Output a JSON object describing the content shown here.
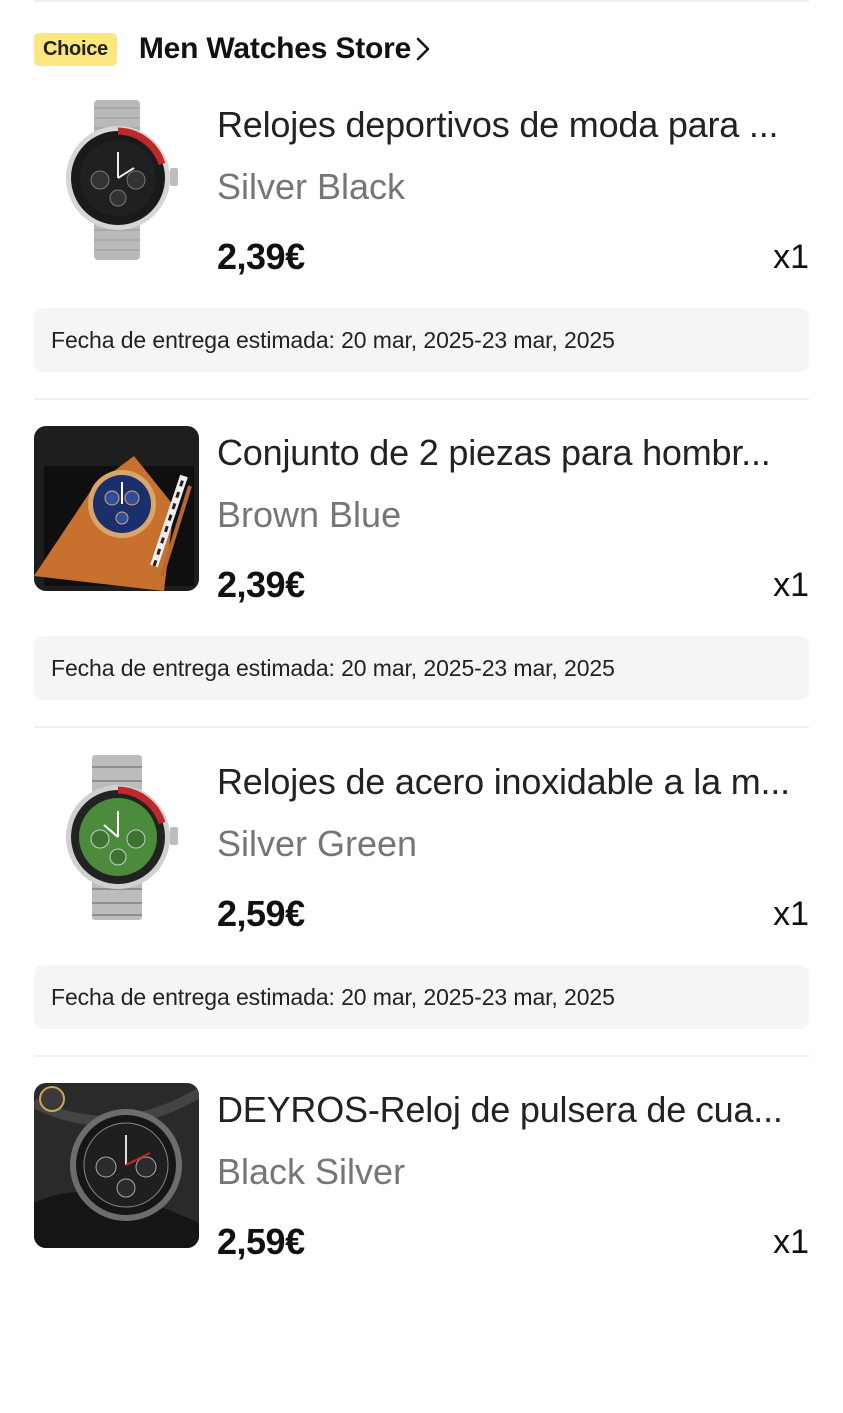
{
  "store": {
    "badge": "Choice",
    "name": "Men Watches Store"
  },
  "products": [
    {
      "title": "Relojes deportivos de moda para ...",
      "variant": "Silver Black",
      "price": "2,39€",
      "quantity": "x1",
      "delivery": "Fecha de entrega estimada: 20 mar, 2025-23 mar, 2025"
    },
    {
      "title": "Conjunto de 2 piezas para hombr...",
      "variant": "Brown Blue",
      "price": "2,39€",
      "quantity": "x1",
      "delivery": "Fecha de entrega estimada: 20 mar, 2025-23 mar, 2025"
    },
    {
      "title": "Relojes de acero inoxidable a la m...",
      "variant": "Silver Green",
      "price": "2,59€",
      "quantity": "x1",
      "delivery": "Fecha de entrega estimada: 20 mar, 2025-23 mar, 2025"
    },
    {
      "title": "DEYROS-Reloj de pulsera de cua...",
      "variant": "Black Silver",
      "price": "2,59€",
      "quantity": "x1"
    }
  ],
  "colors": {
    "choice_badge": "#fbe77e",
    "delivery_bg": "#f5f5f5",
    "variant_text": "#767676"
  }
}
